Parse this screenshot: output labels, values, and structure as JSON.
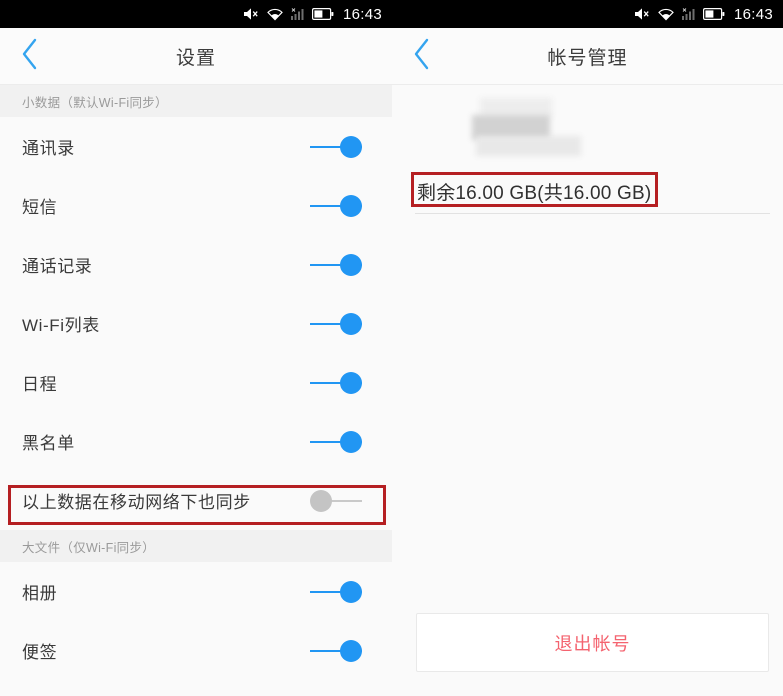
{
  "status_bar": {
    "time": "16:43",
    "icons": [
      "volume-mute-icon",
      "wifi-icon",
      "cellular-signal-off-icon",
      "battery-icon"
    ],
    "background": "#000000"
  },
  "theme": {
    "accent_blue": "#2196f3",
    "toggle_off_gray": "#c4c4c4",
    "annotation_red": "#b51f22",
    "logout_red": "#f4636f",
    "page_bg": "#fafafa",
    "section_band_bg": "#f1f1f1"
  },
  "left_panel": {
    "header": {
      "back_label": "back-chevron",
      "title": "设置"
    },
    "sections": [
      {
        "band_label": "小数据（默认Wi-Fi同步）",
        "rows": [
          {
            "label": "通讯录",
            "toggle": "on"
          },
          {
            "label": "短信",
            "toggle": "on"
          },
          {
            "label": "通话记录",
            "toggle": "on"
          },
          {
            "label": "Wi-Fi列表",
            "toggle": "on"
          },
          {
            "label": "日程",
            "toggle": "on"
          },
          {
            "label": "黑名单",
            "toggle": "on"
          },
          {
            "label": "以上数据在移动网络下也同步",
            "toggle": "off",
            "highlighted": true
          }
        ]
      },
      {
        "band_label": "大文件（仅Wi-Fi同步）",
        "rows": [
          {
            "label": "相册",
            "toggle": "on"
          },
          {
            "label": "便签",
            "toggle": "on"
          }
        ]
      }
    ]
  },
  "right_panel": {
    "header": {
      "back_label": "back-chevron",
      "title": "帐号管理"
    },
    "account": {
      "avatar_state": "redacted-blurred",
      "storage_text": "剩余16.00 GB(共16.00 GB)",
      "storage_highlighted": true
    },
    "logout_button": {
      "label": "退出帐号"
    }
  }
}
